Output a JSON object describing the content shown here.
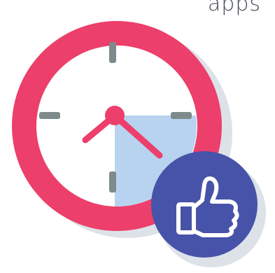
{
  "caption": "apps",
  "illustration": {
    "clock_ring_color": "#ec3f6b",
    "clock_face_color": "#ffffff",
    "tick_color": "#7f8a8c",
    "quarter_highlight_color": "#b7d3ef",
    "hand_color": "#ec3f6b",
    "badge_color": "#4653a8",
    "badge_icon": "thumbs-up-icon",
    "clock_icon": "clock-icon"
  }
}
